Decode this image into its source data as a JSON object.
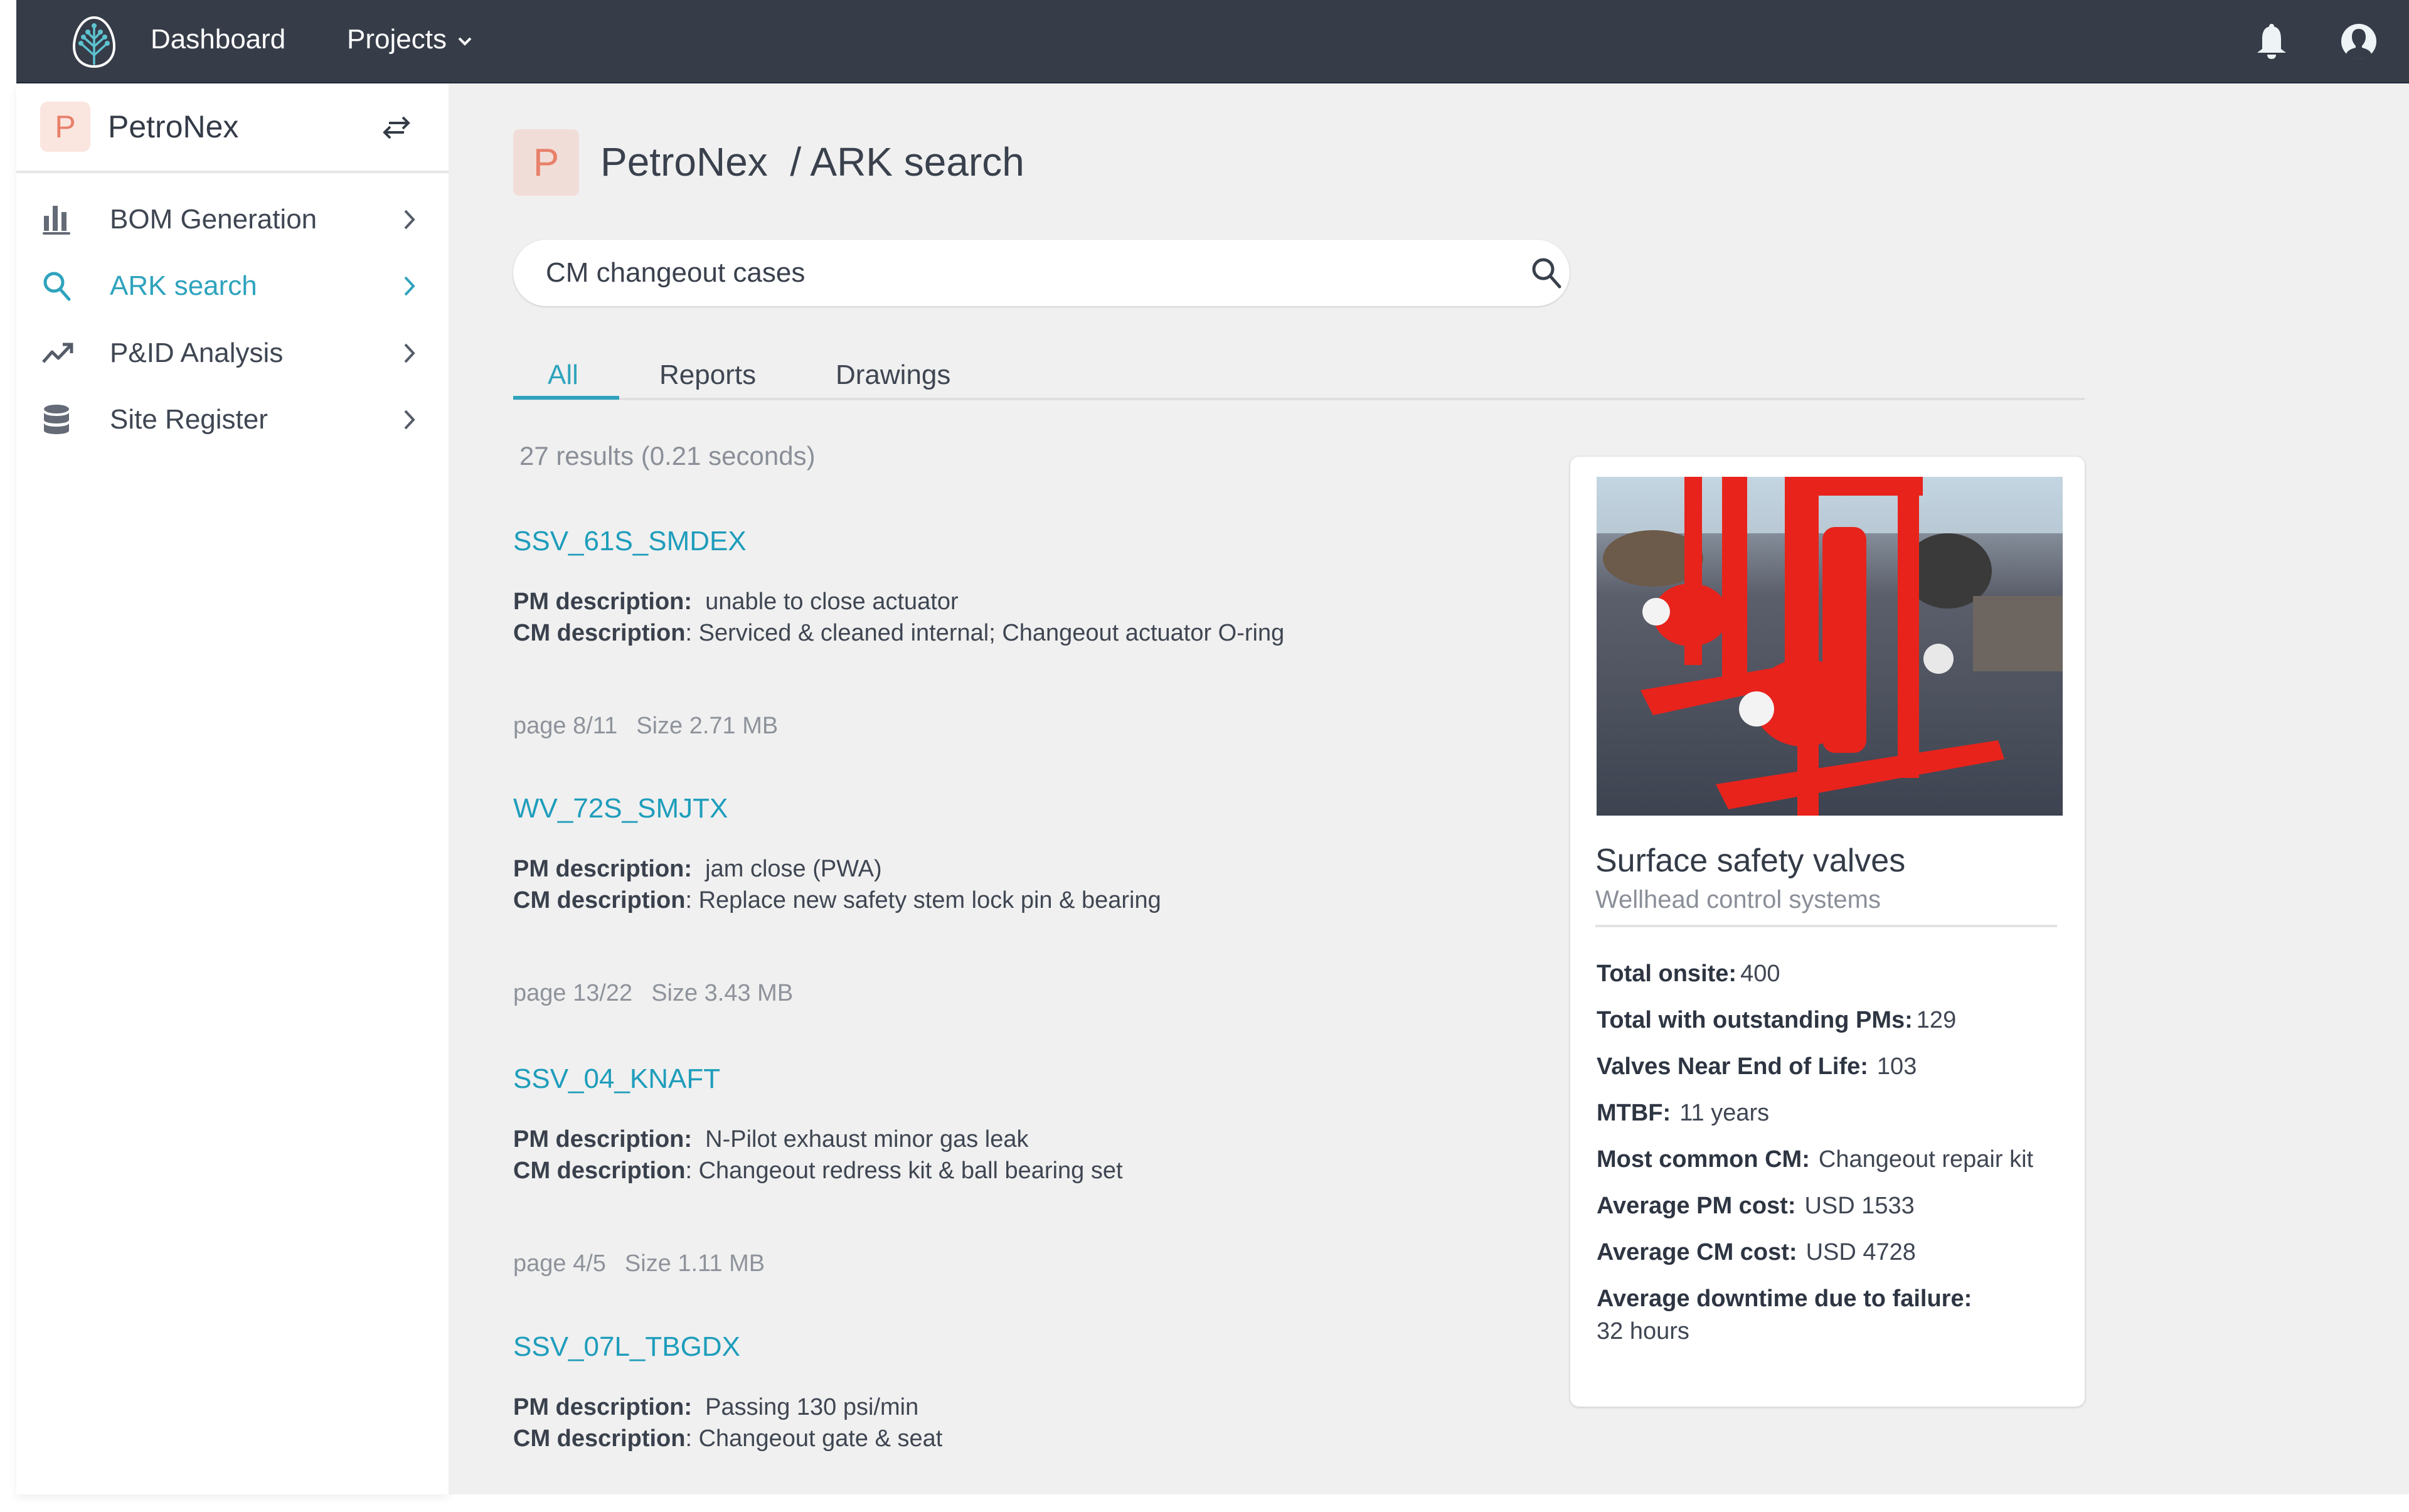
{
  "topbar": {
    "logo": "tree-logo",
    "nav": [
      {
        "label": "Dashboard"
      },
      {
        "label": "Projects",
        "has_dropdown": true
      }
    ],
    "icons": [
      "bell-icon",
      "user-avatar-icon"
    ]
  },
  "sidebar": {
    "project_initial": "P",
    "project_name": "PetroNex",
    "switch_icon": "swap-arrows-icon",
    "items": [
      {
        "label": "BOM Generation",
        "icon": "bar-chart-icon",
        "active": false
      },
      {
        "label": "ARK search",
        "icon": "search-icon",
        "active": true
      },
      {
        "label": "P&ID Analysis",
        "icon": "trend-up-icon",
        "active": false
      },
      {
        "label": "Site Register",
        "icon": "database-icon",
        "active": false
      }
    ]
  },
  "page": {
    "title_initial": "P",
    "title": "PetroNex  / ARK search",
    "search": {
      "value": "CM changeout cases",
      "placeholder": ""
    },
    "tabs": [
      {
        "label": "All",
        "active": true
      },
      {
        "label": "Reports",
        "active": false
      },
      {
        "label": "Drawings",
        "active": false
      }
    ],
    "result_count": "27 results (0.21 seconds)",
    "pm_label": "PM description:",
    "cm_label": "CM description",
    "results": [
      {
        "title": "SSV_61S_SMDEX",
        "pm": "unable to close actuator",
        "cm": "Serviced & cleaned internal; Changeout actuator O-ring",
        "page": "page 8/11",
        "size": "Size 2.71 MB"
      },
      {
        "title": "WV_72S_SMJTX",
        "pm": "jam close (PWA)",
        "cm": "Replace new safety stem lock pin & bearing",
        "page": "page 13/22",
        "size": "Size 3.43 MB"
      },
      {
        "title": "SSV_04_KNAFT",
        "pm": "N-Pilot exhaust minor gas leak",
        "cm": "Changeout redress kit & ball bearing set",
        "page": "page 4/5",
        "size": "Size 1.11 MB"
      },
      {
        "title": "SSV_07L_TBGDX",
        "pm": "Passing 130 psi/min",
        "cm": "Changeout gate & seat",
        "page": "",
        "size": ""
      }
    ]
  },
  "card": {
    "image_alt": "Red surface safety valves on skids",
    "title": "Surface safety valves",
    "subtitle": "Wellhead control systems",
    "stats": [
      {
        "label": "Total onsite:",
        "value": "400"
      },
      {
        "label": "Total with outstanding PMs:",
        "value": "129"
      },
      {
        "label": "Valves Near End of Life:",
        "value": "103"
      },
      {
        "label": "MTBF:",
        "value": "11 years"
      },
      {
        "label": "Most common CM:",
        "value": "Changeout repair kit"
      },
      {
        "label": "Average PM cost:",
        "value": "USD 1533"
      },
      {
        "label": "Average CM cost:",
        "value": "USD 4728"
      },
      {
        "label": "Average downtime due to failure:",
        "value": "32 hours"
      }
    ]
  },
  "colors": {
    "accent": "#2fa3bd",
    "topbar": "#363c48",
    "main_bg": "#f0f0f0",
    "badge_bg": "#fbe5df",
    "badge_text": "#e8806a"
  }
}
